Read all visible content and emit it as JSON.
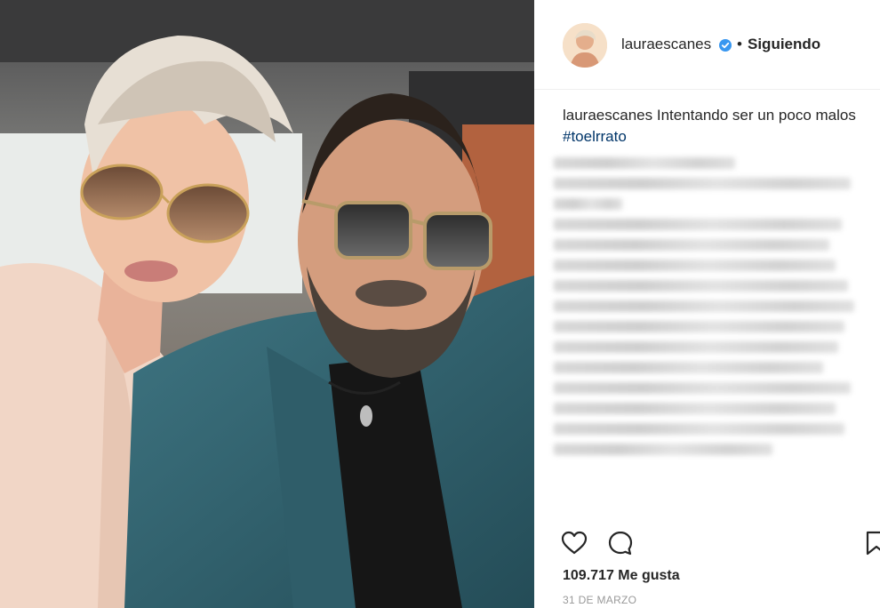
{
  "header": {
    "username": "lauraescanes",
    "separator": "•",
    "follow_status": "Siguiendo"
  },
  "caption": {
    "username": "lauraescanes",
    "text": "Intentando ser un poco malos ",
    "hashtag": "#toelrrato"
  },
  "comments_blurred": true,
  "actions": {
    "icons": [
      "heart-icon",
      "comment-icon",
      "bookmark-icon"
    ]
  },
  "likes": {
    "count": "109.717",
    "label": "Me gusta"
  },
  "date": "31 DE MARZO",
  "colors": {
    "verified": "#3897f0",
    "hashtag": "#003569",
    "text": "#262626",
    "muted": "#999999"
  }
}
